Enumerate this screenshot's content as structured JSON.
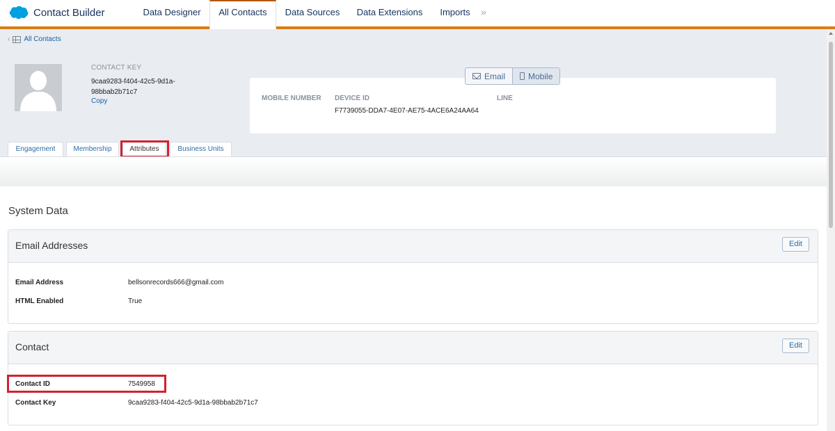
{
  "app": {
    "title": "Contact Builder",
    "brand_color": "#00a1e0",
    "accent_color": "#d97d12"
  },
  "nav": {
    "tabs": [
      {
        "label": "Data Designer",
        "active": false
      },
      {
        "label": "All Contacts",
        "active": true
      },
      {
        "label": "Data Sources",
        "active": false
      },
      {
        "label": "Data Extensions",
        "active": false
      },
      {
        "label": "Imports",
        "active": false
      }
    ],
    "more_glyph": "»"
  },
  "breadcrumb": {
    "chevron": "‹",
    "icon": "list-grid-icon",
    "label": "All Contacts"
  },
  "contact": {
    "key_label": "CONTACT KEY",
    "key_value": "9caa9283-f404-42c5-9d1a-98bbab2b71c7",
    "copy_label": "Copy"
  },
  "channel_toggle": {
    "email_label": "Email",
    "mobile_label": "Mobile",
    "selected": "Mobile"
  },
  "mobile_card": {
    "col_mobile_number": "MOBILE NUMBER",
    "col_device_id": "DEVICE ID",
    "col_line": "LINE",
    "device_id_value": "F7739055-DDA7-4E07-AE75-4ACE6A24AA64"
  },
  "subtabs": [
    {
      "label": "Engagement",
      "active": false
    },
    {
      "label": "Membership",
      "active": false
    },
    {
      "label": "Attributes",
      "active": true,
      "highlighted": true
    },
    {
      "label": "Business Units",
      "active": false
    }
  ],
  "system_data": {
    "title": "System Data",
    "edit_label": "Edit",
    "email_panel": {
      "title": "Email Addresses",
      "rows": [
        {
          "label": "Email Address",
          "value": "bellsonrecords666@gmail.com"
        },
        {
          "label": "HTML Enabled",
          "value": "True"
        }
      ]
    },
    "contact_panel": {
      "title": "Contact",
      "rows": [
        {
          "label": "Contact ID",
          "value": "7549958",
          "highlighted": true
        },
        {
          "label": "Contact Key",
          "value": "9caa9283-f404-42c5-9d1a-98bbab2b71c7"
        }
      ]
    }
  },
  "highlight_color": "#d3202f"
}
